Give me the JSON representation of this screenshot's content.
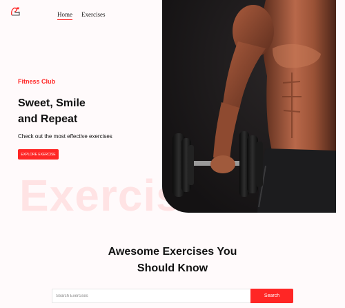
{
  "nav": {
    "logo_icon": "dumbbell-heart-logo-icon",
    "links": [
      {
        "label": "Home",
        "active": true
      },
      {
        "label": "Exercises",
        "active": false
      }
    ]
  },
  "hero": {
    "tagline": "Fitness Club",
    "title_line1": "Sweet, Smile",
    "title_line2": "and Repeat",
    "subtitle": "Check out the most effective exercises",
    "button_label": "Explore Exercise",
    "watermark": "Exercise",
    "image": "muscular-man-holding-dumbbell-photo"
  },
  "exercises_section": {
    "title_line1": "Awesome Exercises You",
    "title_line2": "Should Know"
  },
  "search": {
    "placeholder": "Search Exercises",
    "value": "",
    "button_label": "Search"
  },
  "colors": {
    "accent": "#ff2625",
    "background": "#fffafb",
    "hero_bg": "#1a1819"
  }
}
